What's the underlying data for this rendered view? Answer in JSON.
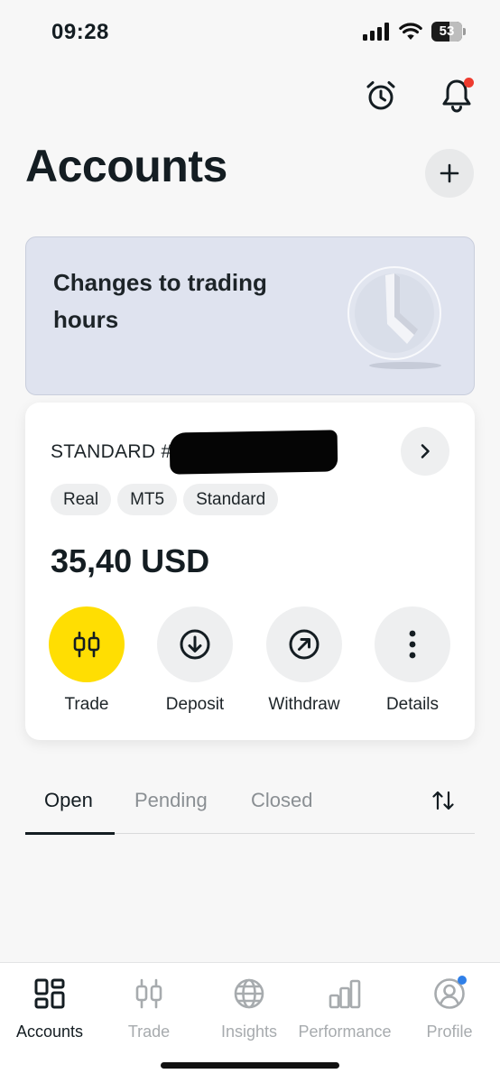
{
  "status_bar": {
    "time": "09:28",
    "battery_level": "53",
    "signal_icon": "cellular-signal-icon",
    "wifi_icon": "wifi-icon"
  },
  "header": {
    "title": "Accounts",
    "alarm_icon": "alarm-clock-icon",
    "bell_icon": "bell-icon",
    "add_icon": "plus-icon",
    "notification_dot_color": "#ee3b2f"
  },
  "banner": {
    "text": "Changes to trading hours",
    "background_color": "#dfe3ef"
  },
  "account": {
    "name": "STANDARD #",
    "tags": [
      "Real",
      "MT5",
      "Standard"
    ],
    "balance": "35,40 USD",
    "actions": [
      {
        "label": "Trade",
        "icon": "candlestick-icon"
      },
      {
        "label": "Deposit",
        "icon": "arrow-down-circle-icon"
      },
      {
        "label": "Withdraw",
        "icon": "arrow-up-right-circle-icon"
      },
      {
        "label": "Details",
        "icon": "more-vertical-icon"
      }
    ],
    "primary_color": "#ffde02"
  },
  "tabs": {
    "items": [
      "Open",
      "Pending",
      "Closed"
    ],
    "active": "Open",
    "sort_icon": "sort-arrows-icon"
  },
  "bottom_nav": {
    "items": [
      {
        "label": "Accounts",
        "icon": "accounts-grid-icon",
        "active": true
      },
      {
        "label": "Trade",
        "icon": "candlestick-icon",
        "active": false
      },
      {
        "label": "Insights",
        "icon": "globe-icon",
        "active": false
      },
      {
        "label": "Performance",
        "icon": "bar-chart-icon",
        "active": false
      },
      {
        "label": "Profile",
        "icon": "user-circle-icon",
        "active": false
      }
    ],
    "profile_dot_color": "#2f7fe8"
  }
}
